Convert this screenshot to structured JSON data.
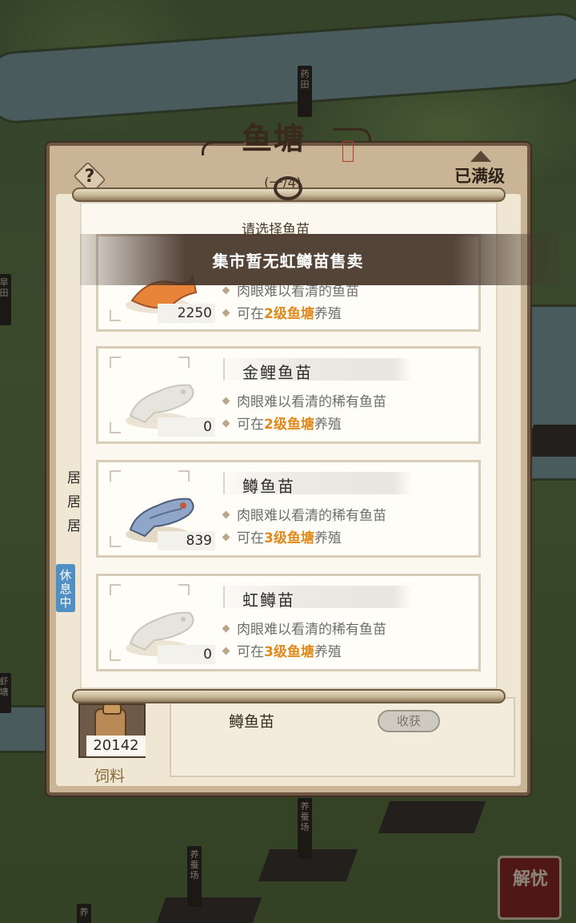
{
  "pond": {
    "title": "鱼塘",
    "subtitle": "(一/4)",
    "max_level": "已满级",
    "help_icon": "?",
    "side_tag": "休息中",
    "side_lines": [
      "居",
      "居",
      "居"
    ]
  },
  "popup": {
    "heading": "请选择鱼苗",
    "toast": "集市暂无虹鳟苗售卖"
  },
  "fish_list": [
    {
      "name": "",
      "count": "2250",
      "desc": "肉眼难以看清的鱼苗",
      "farm_prefix": "可在",
      "farm_level": "2级鱼塘",
      "farm_suffix": "养殖",
      "icon": "orange-fish-icon",
      "color": "#e8833a"
    },
    {
      "name": "金鲤鱼苗",
      "count": "0",
      "desc": "肉眼难以看清的稀有鱼苗",
      "farm_prefix": "可在",
      "farm_level": "2级鱼塘",
      "farm_suffix": "养殖",
      "icon": "golden-carp-icon",
      "color": "#e6e4dc"
    },
    {
      "name": "鳟鱼苗",
      "count": "839",
      "desc": "肉眼难以看清的稀有鱼苗",
      "farm_prefix": "可在",
      "farm_level": "3级鱼塘",
      "farm_suffix": "养殖",
      "icon": "trout-icon",
      "color": "#8fa6c8"
    },
    {
      "name": "虹鳟苗",
      "count": "0",
      "desc": "肉眼难以看清的稀有鱼苗",
      "farm_prefix": "可在",
      "farm_level": "3级鱼塘",
      "farm_suffix": "养殖",
      "icon": "rainbow-trout-icon",
      "color": "#e6e4dc"
    }
  ],
  "bottom": {
    "feed_count": "20142",
    "feed_label": "饲料",
    "current_fish": "鳟鱼苗",
    "harvest": "收获"
  },
  "map": {
    "signs": [
      "药田",
      "旱田",
      "养蚕场",
      "养蚕场",
      "虾塘",
      "养"
    ],
    "seal": "解忧"
  },
  "colors": {
    "highlight": "#e08a1e",
    "toast_bg": "#463428",
    "tag_blue": "#4f8fc4"
  }
}
